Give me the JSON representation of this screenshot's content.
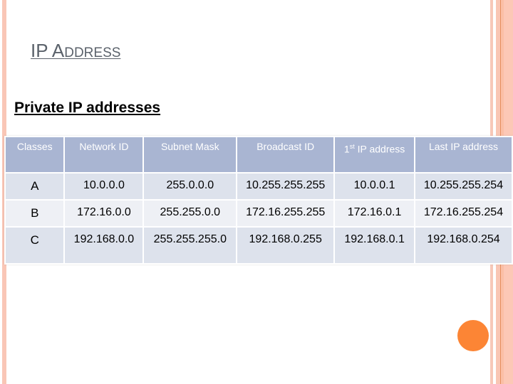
{
  "slide": {
    "title_first": "IP A",
    "title_rest": "DDRESS",
    "subtitle": "Private IP addresses"
  },
  "table": {
    "headers": {
      "classes": "Classes",
      "network_id": "Network ID",
      "subnet_mask": "Subnet Mask",
      "broadcast_id": "Broadcast ID",
      "first_ip_num": "1",
      "first_ip_sup": "st",
      "first_ip_rest": " IP address",
      "last_ip": "Last IP address"
    },
    "rows": [
      {
        "class": "A",
        "network_id": "10.0.0.0",
        "subnet_mask": "255.0.0.0",
        "broadcast_id": "10.255.255.255",
        "first_ip": "10.0.0.1",
        "last_ip": "10.255.255.254"
      },
      {
        "class": "B",
        "network_id": "172.16.0.0",
        "subnet_mask": "255.255.0.0",
        "broadcast_id": "172.16.255.255",
        "first_ip": "172.16.0.1",
        "last_ip": "172.16.255.254"
      },
      {
        "class": "C",
        "network_id": "192.168.0.0",
        "subnet_mask": "255.255.255.0",
        "broadcast_id": "192.168.0.255",
        "first_ip": "192.168.0.1",
        "last_ip": "192.168.0.254"
      }
    ]
  },
  "colors": {
    "accent": "#fc8535",
    "header_bg": "#a9b5d2",
    "row_dark": "#dde2ec",
    "row_light": "#eef0f5",
    "stripe": "#f9c6b6"
  }
}
